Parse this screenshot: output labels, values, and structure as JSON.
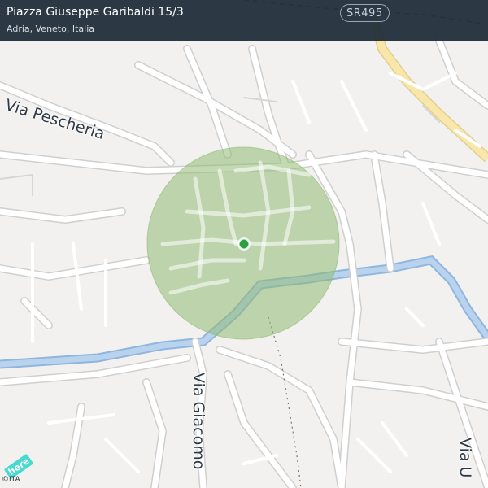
{
  "header": {
    "title": "Piazza Giuseppe Garibaldi 15/3",
    "subtitle": "Adria, Veneto, Italia"
  },
  "map": {
    "road_shield": "SR495",
    "street_labels": {
      "pescheria": "Via Pescheria",
      "giacomo": "Via Giacomo",
      "right": "Via U"
    },
    "location_marker": {
      "color": "#2ea043",
      "label": ""
    },
    "accuracy_circle_color": "#8fba72",
    "water_color": "#a9c8e8",
    "land_color": "#f2f1ef",
    "road_color": "#ffffff",
    "major_road_color": "#f7e3a5"
  },
  "footer": {
    "brand": "here",
    "copyright": "©ITA"
  }
}
